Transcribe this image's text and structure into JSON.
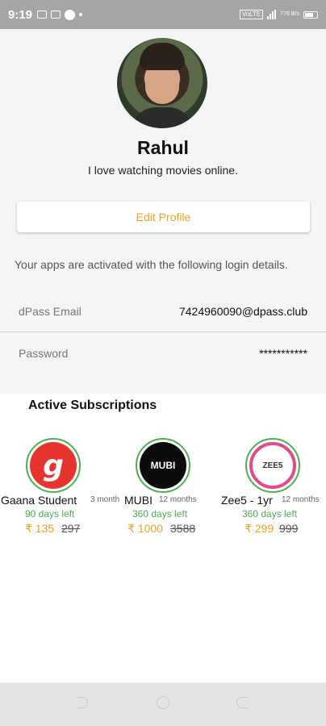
{
  "status_bar": {
    "time": "9:19",
    "network": "VoLTE",
    "speed": "776 B/s"
  },
  "profile": {
    "name": "Rahul",
    "bio": "I love watching movies online.",
    "edit_label": "Edit Profile",
    "login_info": "Your apps are activated with the following login details."
  },
  "credentials": {
    "email_label": "dPass Email",
    "email_value": "7424960090@dpass.club",
    "password_label": "Password",
    "password_value": "***********"
  },
  "subscriptions": {
    "title": "Active Subscriptions",
    "items": [
      {
        "name": "Gaana Student",
        "duration": "3 month",
        "days_left": "90 days left",
        "price": "₹ 135",
        "mrp": "297",
        "logo_text": "g"
      },
      {
        "name": "MUBI",
        "duration": "12 months",
        "days_left": "360 days left",
        "price": "₹ 1000",
        "mrp": "3588",
        "logo_text": "MUBI"
      },
      {
        "name": "Zee5 - 1yr",
        "duration": "12 months",
        "days_left": "360 days left",
        "price": "₹ 299",
        "mrp": "999",
        "logo_text": "ZEE5"
      }
    ]
  },
  "colors": {
    "accent": "#f0a020",
    "active_green": "#4caf50",
    "gaana_red": "#e8342f"
  }
}
